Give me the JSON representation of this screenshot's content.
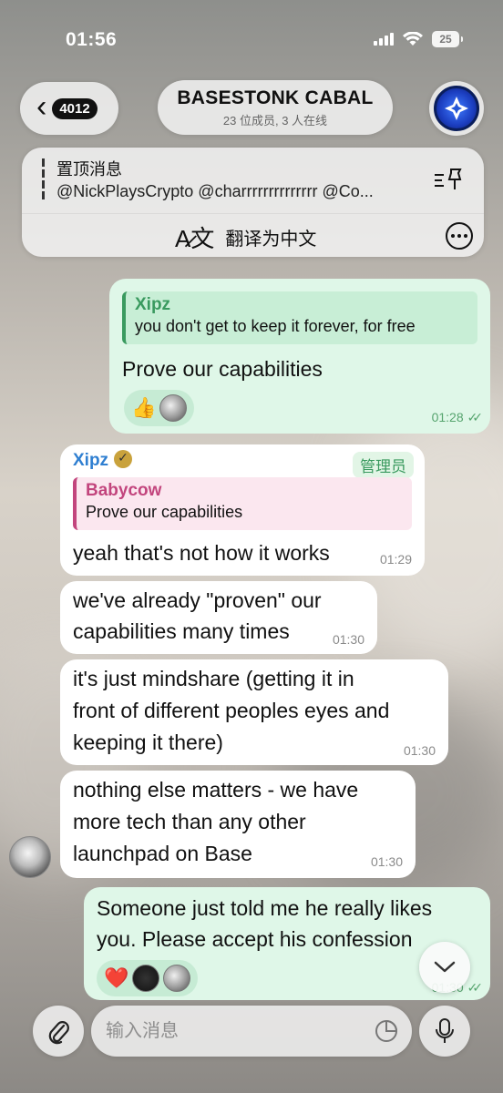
{
  "status_bar": {
    "time": "01:56",
    "battery": "25"
  },
  "header": {
    "back_count": "4012",
    "title": "BASESTONK CABAL",
    "subtitle": "23 位成员, 3 人在线"
  },
  "pinned": {
    "title": "置顶消息",
    "text": "@NickPlaysCrypto @charrrrrrrrrrrrrr @Co...",
    "translate_label": "翻译为中文"
  },
  "messages": [
    {
      "quote_sender": "Xipz",
      "quote_text": "you don't get to keep it forever, for free",
      "text": "Prove our capabilities",
      "time": "01:28",
      "reaction": "👍"
    },
    {
      "sender": "Xipz",
      "badge": "管理员",
      "quote_sender": "Babycow",
      "quote_text": "Prove our capabilities",
      "text": "yeah that's not how it works",
      "time": "01:29"
    },
    {
      "text_line1": "we've already \"proven\" our",
      "text_line2": "capabilities many times",
      "time": "01:30"
    },
    {
      "text_line1": "it's just mindshare (getting it in",
      "text_line2": "front of different peoples eyes and",
      "text_line3": "keeping it there)",
      "time": "01:30"
    },
    {
      "text_line1": "nothing else matters - we have",
      "text_line2": "more tech than any other",
      "text_line3": "launchpad on Base",
      "time": "01:30"
    },
    {
      "text_line1": "Someone just told me he really likes",
      "text_line2": "you. Please accept his confession",
      "reaction": "❤️",
      "time": "01:30"
    }
  ],
  "input": {
    "placeholder": "输入消息"
  },
  "colors": {
    "outgoing_bubble": "#dff7e8",
    "incoming_bubble": "#ffffff",
    "accent_green": "#3a9a5f",
    "sender_blue": "#2f7fd1",
    "quote_pink": "#c2457d"
  },
  "icons": [
    "back-chevron-icon",
    "pin-icon",
    "translate-icon",
    "more-icon",
    "attach-icon",
    "sticker-icon",
    "mic-icon",
    "chevron-down-icon"
  ]
}
